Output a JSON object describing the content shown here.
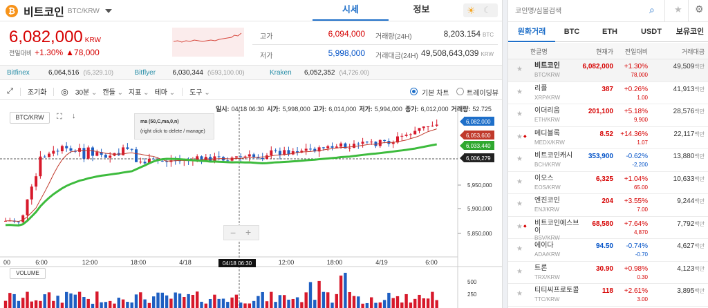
{
  "header": {
    "coin_name": "비트코인",
    "pair": "BTC/KRW",
    "icon": "bitcoin-icon",
    "tab_price": "시세",
    "tab_info": "정보",
    "price": "6,082,000",
    "price_unit": "KRW",
    "change_label": "전일대비",
    "change_pct": "+1.30%",
    "change_amt": "▲78,000",
    "high_label": "고가",
    "high": "6,094,000",
    "low_label": "저가",
    "low": "5,998,000",
    "vol_label": "거래량(24H)",
    "vol": "8,203.154",
    "vol_unit": "BTC",
    "amt_label": "거래대금(24H)",
    "amt": "49,508,643,039",
    "amt_unit": "KRW"
  },
  "exchanges": [
    {
      "name": "Bitfinex",
      "price": "6,064,516",
      "diff": "(\\5,329.10)"
    },
    {
      "name": "Bitflyer",
      "price": "6,030,344",
      "diff": "(\\593,100.00)"
    },
    {
      "name": "Kraken",
      "price": "6,052,352",
      "diff": "(\\4,726.00)"
    }
  ],
  "toolbar": {
    "reset": "조기화",
    "interval": "30분",
    "candle": "캔들",
    "indicator": "지표",
    "theme": "테마",
    "tools": "도구",
    "basic_chart": "기본 차트",
    "tradingview": "트레이딩뷰"
  },
  "ohlc": {
    "date_label": "일시:",
    "date": "04/18 06:30",
    "open_label": "시가:",
    "open": "5,998,000",
    "high_label": "고가:",
    "high": "6,014,000",
    "low_label": "저가:",
    "low": "5,994,000",
    "close_label": "종가:",
    "close": "6,012,000",
    "vol_label": "거래량:",
    "vol": "52.725"
  },
  "chart": {
    "pair_label": "BTC/KRW",
    "ma_title": "ma (50,C,ma,0,n)",
    "ma_hint": "(right click to delete / manage)",
    "price_tags": [
      {
        "label": "6,082,000",
        "color": "#1e6fc9"
      },
      {
        "label": "6,053,600",
        "color": "#c0392b"
      },
      {
        "label": "6,033,440",
        "color": "#2fa82f"
      },
      {
        "label": "6,006,279",
        "color": "#222222"
      }
    ],
    "y_ticks": [
      "5,950,000",
      "5,900,000",
      "5,850,000"
    ],
    "x_ticks": [
      "00",
      "6:00",
      "12:00",
      "18:00",
      "4/18",
      "6:00",
      "12:00",
      "18:00",
      "4/19",
      "6:00"
    ],
    "x_cursor": "04/18 06:30",
    "volume_label": "VOLUME",
    "vol_ticks": [
      "500",
      "250"
    ],
    "zoom_out": "−",
    "zoom_in": "+"
  },
  "sidebar": {
    "search_placeholder": "코인명/심볼검색",
    "tabs": [
      "원화거래",
      "BTC",
      "ETH",
      "USDT",
      "보유코인"
    ],
    "columns": [
      "한글명",
      "현재가",
      "전일대비",
      "거래대금"
    ],
    "unit": "백만",
    "coins": [
      {
        "name": "비트코인",
        "sym": "BTC/KRW",
        "price": "6,082,000",
        "pct": "+1.30%",
        "chg": "78,000",
        "amt": "49,509",
        "dir": "up",
        "sel": true
      },
      {
        "name": "리플",
        "sym": "XRP/KRW",
        "price": "387",
        "pct": "+0.26%",
        "chg": "1.00",
        "amt": "41,913",
        "dir": "up"
      },
      {
        "name": "이더리움",
        "sym": "ETH/KRW",
        "price": "201,100",
        "pct": "+5.18%",
        "chg": "9,900",
        "amt": "28,576",
        "dir": "up"
      },
      {
        "name": "메디블록",
        "sym": "MEDX/KRW",
        "price": "8.52",
        "pct": "+14.36%",
        "chg": "1.07",
        "amt": "22,117",
        "dir": "up",
        "warn": true
      },
      {
        "name": "비트코인캐시",
        "sym": "BCH/KRW",
        "price": "353,900",
        "pct": "-0.62%",
        "chg": "-2,200",
        "amt": "13,880",
        "dir": "down"
      },
      {
        "name": "이오스",
        "sym": "EOS/KRW",
        "price": "6,325",
        "pct": "+1.04%",
        "chg": "65.00",
        "amt": "10,633",
        "dir": "up"
      },
      {
        "name": "엔진코인",
        "sym": "ENJ/KRW",
        "price": "204",
        "pct": "+3.55%",
        "chg": "7.00",
        "amt": "9,244",
        "dir": "up"
      },
      {
        "name": "비트코인에스브이",
        "sym": "BSV/KRW",
        "price": "68,580",
        "pct": "+7.64%",
        "chg": "4,870",
        "amt": "7,792",
        "dir": "up",
        "warn": true
      },
      {
        "name": "에이다",
        "sym": "ADA/KRW",
        "price": "94.50",
        "pct": "-0.74%",
        "chg": "-0.70",
        "amt": "4,627",
        "dir": "down"
      },
      {
        "name": "트론",
        "sym": "TRX/KRW",
        "price": "30.90",
        "pct": "+0.98%",
        "chg": "0.30",
        "amt": "4,123",
        "dir": "up"
      },
      {
        "name": "티티씨프로토콜",
        "sym": "TTC/KRW",
        "price": "118",
        "pct": "+2.61%",
        "chg": "3.00",
        "amt": "3,895",
        "dir": "up"
      }
    ]
  }
}
